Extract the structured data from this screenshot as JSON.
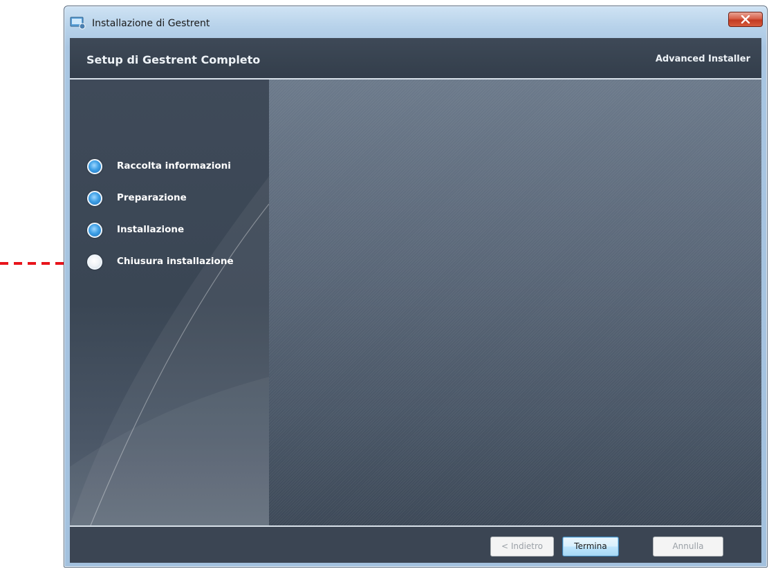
{
  "window": {
    "title": "Installazione di Gestrent"
  },
  "header": {
    "title": "Setup di Gestrent Completo",
    "brand": "Advanced Installer"
  },
  "steps": [
    {
      "label": "Raccolta informazioni",
      "state": "completed"
    },
    {
      "label": "Preparazione",
      "state": "completed"
    },
    {
      "label": "Installazione",
      "state": "completed"
    },
    {
      "label": "Chiusura installazione",
      "state": "current"
    }
  ],
  "footer": {
    "back_label": "< Indietro",
    "finish_label": "Termina",
    "cancel_label": "Annulla"
  },
  "colors": {
    "step_completed": "#3fa0e6",
    "step_current": "#ffffff",
    "annotation_arrow": "#e8141b",
    "close_button": "#c33a22"
  },
  "icons": {
    "window_icon": "installer-icon",
    "close_icon": "close-icon",
    "annotation": "arrow-right-icon"
  }
}
